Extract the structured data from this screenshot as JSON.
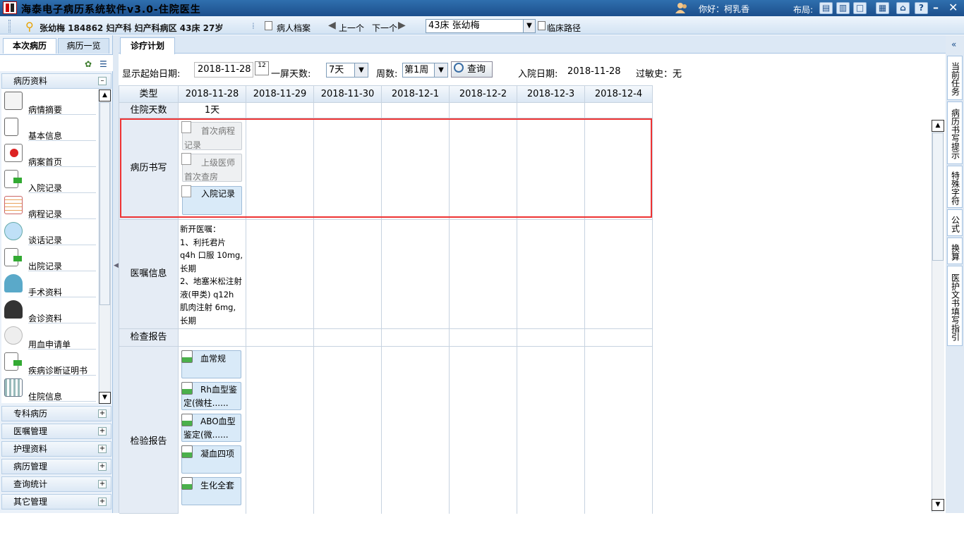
{
  "window": {
    "title": "海泰电子病历系统软件v3.0-住院医生",
    "greeting": "你好：柯乳香",
    "layout_label": "布局:"
  },
  "patient_bar": {
    "info": "张幼梅 184862 妇产科 妇产科病区 43床 27岁",
    "archive": "病人档案",
    "prev": "上一个",
    "next": "下一个",
    "selected_bed": "43床 张幼梅",
    "pathway": "临床路径"
  },
  "left_panel": {
    "tabs": [
      "本次病历",
      "病历一览"
    ],
    "section_top": "病历资料",
    "items": [
      "病情摘要",
      "基本信息",
      "病案首页",
      "入院记录",
      "病程记录",
      "谈话记录",
      "出院记录",
      "手术资料",
      "会诊资料",
      "用血申请单",
      "疾病诊断证明书",
      "住院信息"
    ],
    "sections": [
      "专科病历",
      "医嘱管理",
      "护理资料",
      "病历管理",
      "查询统计",
      "其它管理"
    ]
  },
  "main": {
    "tab": "诊疗计划",
    "query": {
      "start_label": "显示起始日期:",
      "start_date": "2018-11-28",
      "days_label": "一屏天数:",
      "days_value": "7天",
      "weeks_label": "周数:",
      "weeks_value": "第1周",
      "query_btn": "查询",
      "admit_label": "入院日期:",
      "admit_date": "2018-11-28",
      "allergy": "过敏史：无"
    },
    "grid": {
      "type_header": "类型",
      "dates": [
        "2018-11-28",
        "2018-11-29",
        "2018-11-30",
        "2018-12-1",
        "2018-12-2",
        "2018-12-3",
        "2018-12-4"
      ],
      "stay_label": "住院天数",
      "stay_value": "1天",
      "rows": {
        "records": "病历书写",
        "orders": "医嘱信息",
        "exam": "检查报告",
        "lab": "检验报告"
      },
      "record_docs": [
        "首次病程记录",
        "上级医师首次查房记......",
        "入院记录"
      ],
      "orders_text": [
        "新开医嘱：",
        "1、利托君片",
        "q4h 口服  10mg,",
        "长期",
        "2、地塞米松注射",
        "液(甲类)   q12h",
        "肌肉注射  6mg,",
        "长期"
      ],
      "labs": [
        "血常规",
        "Rh血型鉴定(微柱......",
        "ABO血型鉴定(微......",
        "凝血四项",
        "生化全套"
      ]
    }
  },
  "right_tabs": [
    "当前任务",
    "病历书写提示",
    "特殊字符",
    "公式",
    "换算",
    "医护文书填写指引"
  ]
}
